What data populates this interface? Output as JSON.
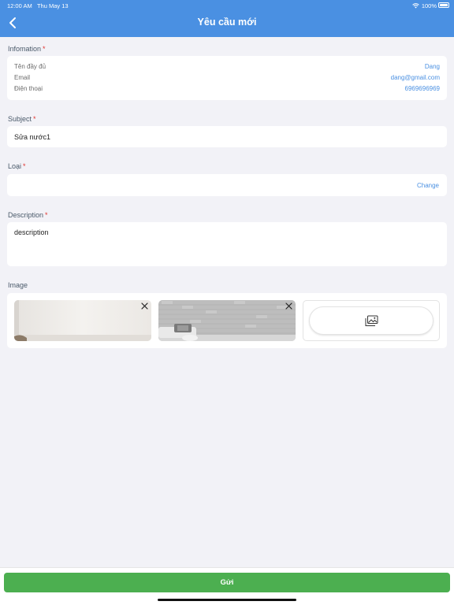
{
  "status_bar": {
    "time": "12:00 AM",
    "date": "Thu May 13",
    "battery": "100%"
  },
  "header": {
    "title": "Yêu cầu mới"
  },
  "information": {
    "label": "Infomation",
    "required_mark": "*",
    "rows": [
      {
        "label": "Tên đầy đủ",
        "value": "Dang"
      },
      {
        "label": "Email",
        "value": "dang@gmail.com"
      },
      {
        "label": "Điện thoại",
        "value": "6969696969"
      }
    ]
  },
  "subject": {
    "label": "Subject",
    "required_mark": "*",
    "value": "Sửa nước1"
  },
  "type": {
    "label": "Loại",
    "required_mark": "*",
    "value": "",
    "change_label": "Change"
  },
  "description": {
    "label": "Description",
    "required_mark": "*",
    "value": "description"
  },
  "image": {
    "label": "Image"
  },
  "footer": {
    "submit_label": "Gửi"
  },
  "colors": {
    "accent": "#4a90e2",
    "submit": "#4caf50",
    "required": "#e0342f"
  }
}
